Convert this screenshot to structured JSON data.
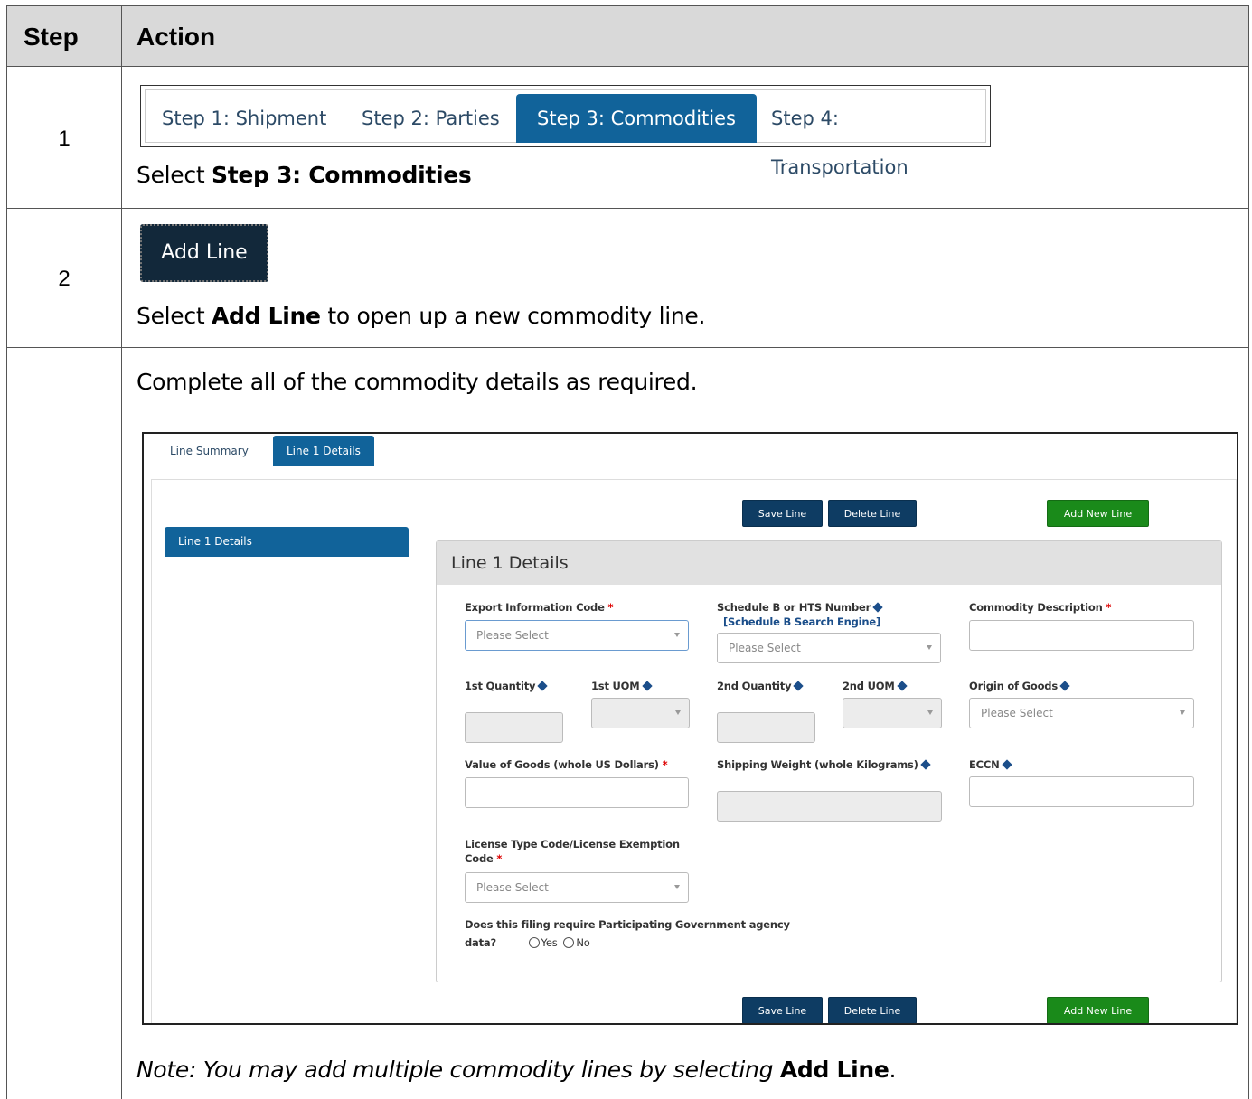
{
  "table": {
    "header_step": "Step",
    "header_action": "Action"
  },
  "step1": {
    "number": "1",
    "tabs": [
      "Step 1: Shipment",
      "Step 2: Parties",
      "Step 3: Commodities",
      "Step 4: Transportation"
    ],
    "instruction_prefix": "Select ",
    "instruction_bold": "Step 3: Commodities"
  },
  "step2": {
    "number": "2",
    "button_label": "Add Line",
    "instruction_prefix": "Select ",
    "instruction_bold": "Add Line",
    "instruction_suffix": " to open up a new commodity line."
  },
  "step3": {
    "instruction": "Complete all of the commodity details as required.",
    "note_italic": "Note: You may add multiple commodity lines by selecting ",
    "note_bold": "Add Line",
    "note_end": "."
  },
  "form": {
    "tabs": {
      "summary": "Line Summary",
      "details": "Line 1 Details"
    },
    "buttons": {
      "save": "Save Line",
      "delete": "Delete Line",
      "add_new": "Add New Line"
    },
    "side_item": "Line 1 Details",
    "panel_title": "Line 1 Details",
    "placeholder": "Please Select",
    "required_mark": "*",
    "fields": {
      "export_code": "Export Information Code",
      "schedule_b": "Schedule B or HTS Number",
      "schedule_b_link": "[Schedule B Search Engine]",
      "commodity_desc": "Commodity Description",
      "qty1": "1st Quantity",
      "uom1": "1st UOM",
      "qty2": "2nd Quantity",
      "uom2": "2nd UOM",
      "origin": "Origin of Goods",
      "value": "Value of Goods (whole US Dollars)",
      "weight": "Shipping Weight (whole Kilograms)",
      "eccn": "ECCN",
      "license_line1": "License Type Code/License Exemption",
      "license_line2": "Code",
      "pga_line1": "Does this filing require Participating Government agency",
      "pga_line2": "data?",
      "yes": "Yes",
      "no": "No"
    }
  }
}
